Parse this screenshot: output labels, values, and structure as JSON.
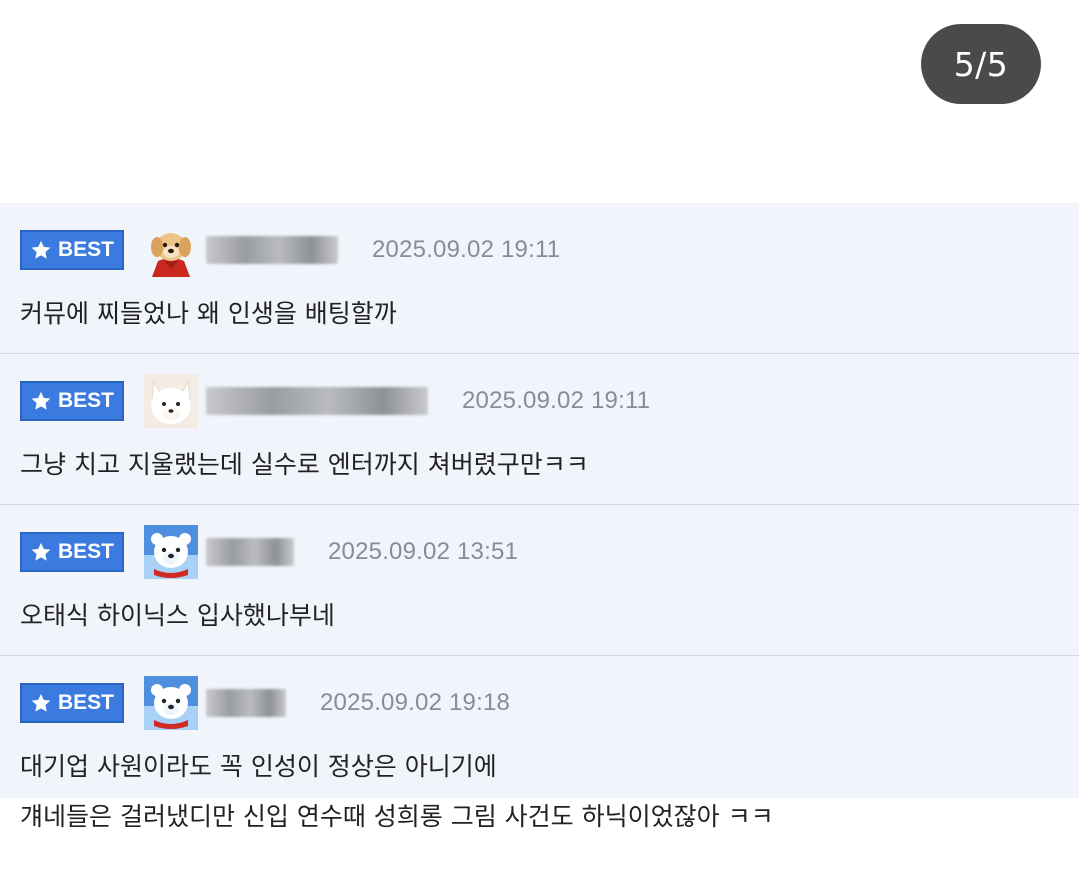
{
  "pager": {
    "label": "5/5"
  },
  "comments": [
    {
      "badge": "BEST",
      "avatar_icon": "golden-puppy-icon",
      "date": "2025.09.02 19:11",
      "lines": [
        "커뮤에 찌들었나 왜 인생을 배팅할까"
      ]
    },
    {
      "badge": "BEST",
      "avatar_icon": "white-fox-dog-icon",
      "date": "2025.09.02 19:11",
      "lines": [
        "그냥 치고 지울랬는데 실수로 엔터까지 쳐버렸구만ㅋㅋ"
      ]
    },
    {
      "badge": "BEST",
      "avatar_icon": "polar-bear-icon",
      "date": "2025.09.02 13:51",
      "lines": [
        "오태식 하이닉스 입사했나부네"
      ]
    },
    {
      "badge": "BEST",
      "avatar_icon": "polar-bear-icon",
      "date": "2025.09.02 19:18",
      "lines": [
        "대기업 사원이라도 꼭 인성이 정상은 아니기에",
        "걔네들은 걸러냈디만 신입 연수때 성희롱 그림 사건도 하닉이었잖아 ㅋㅋ"
      ]
    }
  ],
  "colors": {
    "badge_blue": "#3b7be0",
    "row_bg": "#f1f5fb",
    "date_gray": "#888c93",
    "pager_bg": "#4a4a4a"
  }
}
